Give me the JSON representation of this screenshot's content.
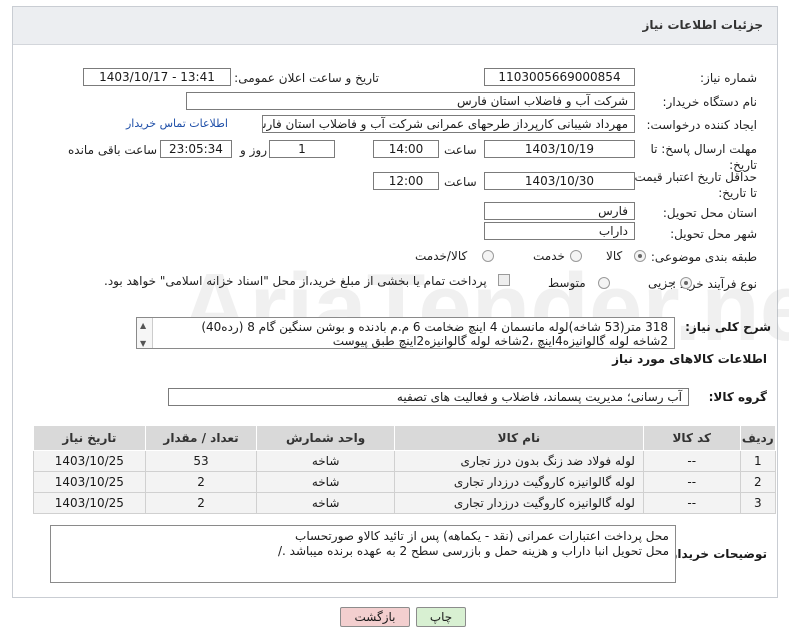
{
  "header": {
    "title": "جزئیات اطلاعات نیاز"
  },
  "labels": {
    "need_number": "شماره نیاز:",
    "announce_datetime": "تاریخ و ساعت اعلان عمومی:",
    "buyer_org": "نام دستگاه خریدار:",
    "requester": "ایجاد کننده درخواست:",
    "deadline": "مهلت ارسال پاسخ: تا تاریخ:",
    "price_validity": "حداقل تاریخ اعتبار قیمت: تا تاریخ:",
    "hour": "ساعت",
    "day_and": "روز و",
    "hours_left": "ساعت باقی مانده",
    "delivery_province": "استان محل تحویل:",
    "delivery_city": "شهر محل تحویل:",
    "category": "طبقه بندی موضوعی:",
    "purchase_type": "نوع فرآیند خرید :",
    "general_desc": "شرح کلی نیاز:",
    "goods_info": "اطلاعات کالاهای مورد نیاز",
    "goods_group": "گروه کالا:",
    "buyer_notes": "توضیحات خریدار:"
  },
  "fields": {
    "need_number": "1103005669000854",
    "announce_datetime": "1403/10/17 - 13:41",
    "buyer_org": "شرکت آب و فاضلاب استان فارس",
    "requester": "مهرداد شیبانی کارپرداز طرحهای عمرانی  شرکت آب و فاضلاب استان فارس",
    "contact_link": "اطلاعات تماس خریدار",
    "deadline_date": "1403/10/19",
    "deadline_time": "14:00",
    "days_left": "1",
    "time_left": "23:05:34",
    "validity_date": "1403/10/30",
    "validity_time": "12:00",
    "province": "فارس",
    "city": "داراب",
    "goods_group": "آب رسانی؛ مدیریت پسماند، فاضلاب و فعالیت های تصفیه"
  },
  "category_options": {
    "goods": "کالا",
    "service": "خدمت",
    "goods_service": "کالا/خدمت",
    "selected": "کالا"
  },
  "purchase_options": {
    "partial": "جزیی",
    "medium": "متوسط",
    "selected": "جزیی"
  },
  "treasury_note": "پرداخت تمام یا بخشی از مبلغ خرید،از محل \"اسناد خزانه اسلامی\" خواهد بود.",
  "general_desc": {
    "line1": "318 متر(53 شاخه)لوله مانسمان 4 اینچ ضخامت 6 م.م بادنده و بوشن سنگین گام 8 (رده40)",
    "line2": "2شاخه لوله گالوانیزه4اینچ ،2شاخه لوله گالوانیزه2اینچ طبق پیوست"
  },
  "table": {
    "headers": [
      "ردیف",
      "کد کالا",
      "نام کالا",
      "واحد شمارش",
      "تعداد / مقدار",
      "تاریخ نیاز"
    ],
    "rows": [
      [
        "1",
        "--",
        "لوله فولاد ضد زنگ بدون درز تجاری",
        "شاخه",
        "53",
        "1403/10/25"
      ],
      [
        "2",
        "--",
        "لوله گالوانیزه کاروگیت درزدار تجاری",
        "شاخه",
        "2",
        "1403/10/25"
      ],
      [
        "3",
        "--",
        "لوله گالوانیزه کاروگیت درزدار تجاری",
        "شاخه",
        "2",
        "1403/10/25"
      ]
    ]
  },
  "buyer_notes": {
    "line1": "محل پرداخت اعتبارات عمرانی (نقد - یکماهه) پس از تائید کالاو صورتحساب",
    "line2": "محل تحویل  انبا داراب و هزینه حمل و بازرسی سطح 2 به عهده برنده میباشد ./"
  },
  "buttons": {
    "print": "چاپ",
    "back": "بازگشت"
  },
  "watermark_text": "AriaTender.net",
  "colors": {
    "header_bg": "#eceef1",
    "table_header": "#d9d9d9",
    "back_btn": "#f3cfcf",
    "print_btn": "#d8f0d2",
    "link": "#1f4fa8"
  }
}
